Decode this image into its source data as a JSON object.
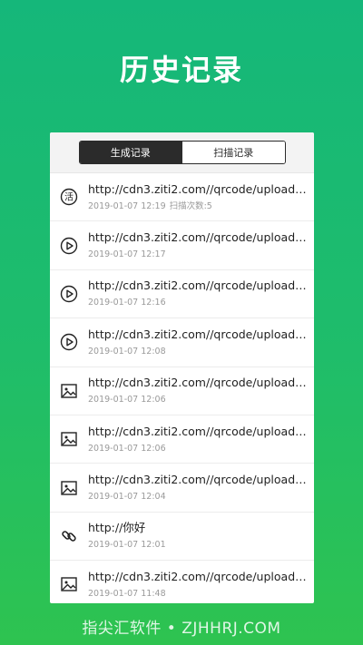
{
  "header": {
    "title": "历史记录"
  },
  "tabs": [
    {
      "label": "生成记录",
      "active": true
    },
    {
      "label": "扫描记录",
      "active": false
    }
  ],
  "records": [
    {
      "icon": "live-code-icon",
      "title": "http://cdn3.ziti2.com//qrcode/uploade...",
      "time": "2019-01-07 12:19",
      "extra": "扫描次数:5"
    },
    {
      "icon": "video-play-icon",
      "title": "http://cdn3.ziti2.com//qrcode/uploade...",
      "time": "2019-01-07 12:17",
      "extra": ""
    },
    {
      "icon": "video-play-icon",
      "title": "http://cdn3.ziti2.com//qrcode/uploade...",
      "time": "2019-01-07 12:16",
      "extra": ""
    },
    {
      "icon": "video-play-icon",
      "title": "http://cdn3.ziti2.com//qrcode/uploade...",
      "time": "2019-01-07 12:08",
      "extra": ""
    },
    {
      "icon": "image-icon",
      "title": "http://cdn3.ziti2.com//qrcode/uploade...",
      "time": "2019-01-07 12:06",
      "extra": ""
    },
    {
      "icon": "image-icon",
      "title": "http://cdn3.ziti2.com//qrcode/uploade...",
      "time": "2019-01-07 12:06",
      "extra": ""
    },
    {
      "icon": "image-icon",
      "title": "http://cdn3.ziti2.com//qrcode/uploade...",
      "time": "2019-01-07 12:04",
      "extra": ""
    },
    {
      "icon": "link-icon",
      "title": "http://你好",
      "time": "2019-01-07 12:01",
      "extra": ""
    },
    {
      "icon": "image-icon",
      "title": "http://cdn3.ziti2.com//qrcode/uploade...",
      "time": "2019-01-07 11:48",
      "extra": ""
    }
  ],
  "watermark": "指尖汇软件 • ZJHHRJ.COM",
  "colors": {
    "accent": "#1cbb6e",
    "tab_active": "#2b2b2b"
  }
}
